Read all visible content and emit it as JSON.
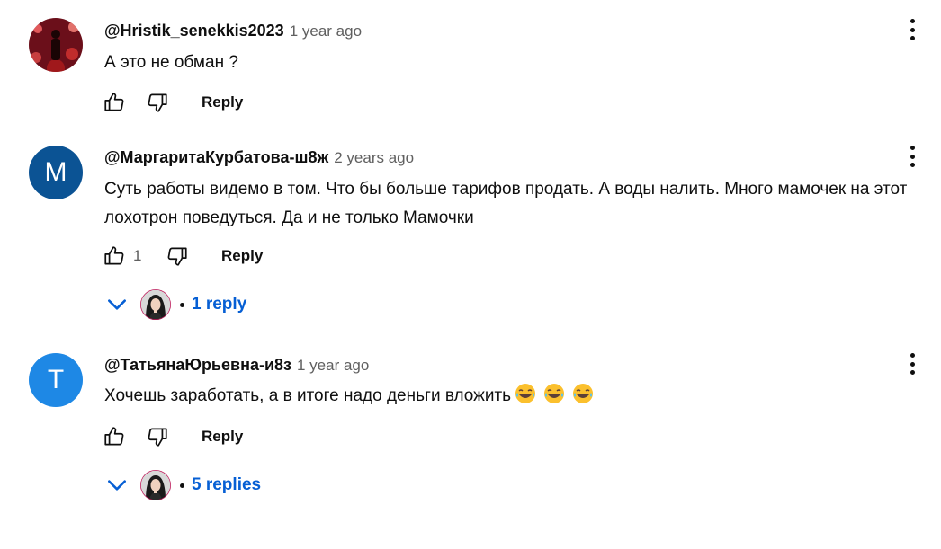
{
  "comments": [
    {
      "author": "@Hristik_senekkis2023",
      "time": "1 year ago",
      "text": "А это не обман ?",
      "likes": "",
      "reply_label": "Reply",
      "avatar_letter": "",
      "avatar_color": "#8a1a2b"
    },
    {
      "author": "@МаргаритаКурбатова-ш8ж",
      "time": "2 years ago",
      "text": "Суть работы видемо в том. Что бы больше тарифов продать. А воды налить. Много мамочек на этот лохотрон поведуться. Да и не только Мамочки",
      "likes": "1",
      "reply_label": "Reply",
      "avatar_letter": "M",
      "avatar_color": "#0b5394",
      "replies_label": "1 reply"
    },
    {
      "author": "@ТатьянаЮрьевна-и8з",
      "time": "1 year ago",
      "text": "Хочешь заработать, а в итоге надо деньги вложить",
      "likes": "",
      "reply_label": "Reply",
      "avatar_letter": "T",
      "avatar_color": "#1e88e5",
      "replies_label": "5 replies"
    }
  ],
  "colors": {
    "link": "#065fd4",
    "muted": "#606060"
  },
  "icons": [
    "like-icon",
    "dislike-icon",
    "more-vert-icon",
    "chevron-down-icon",
    "tears-of-joy-emoji"
  ]
}
